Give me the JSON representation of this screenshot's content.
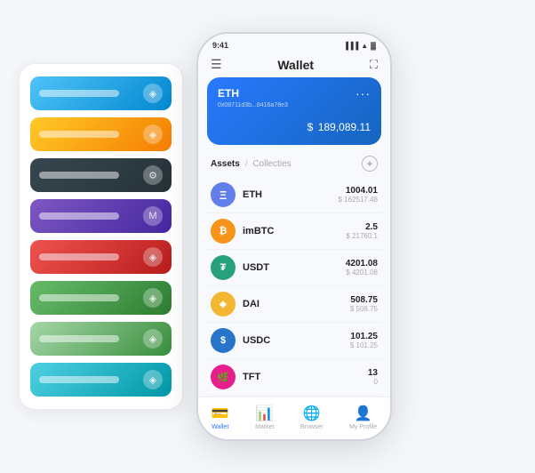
{
  "left_panel": {
    "cards": [
      {
        "id": "card-blue",
        "color_class": "card-blue",
        "icon": "◈"
      },
      {
        "id": "card-orange",
        "color_class": "card-orange",
        "icon": "◈"
      },
      {
        "id": "card-dark",
        "color_class": "card-dark",
        "icon": "⚙"
      },
      {
        "id": "card-purple",
        "color_class": "card-purple",
        "icon": "M"
      },
      {
        "id": "card-red",
        "color_class": "card-red",
        "icon": "◈"
      },
      {
        "id": "card-green",
        "color_class": "card-green",
        "icon": "◈"
      },
      {
        "id": "card-lightgreen",
        "color_class": "card-lightgreen",
        "icon": "◈"
      },
      {
        "id": "card-skyblue",
        "color_class": "card-skyblue",
        "icon": "◈"
      }
    ]
  },
  "phone": {
    "status_bar": {
      "time": "9:41",
      "signal": "▐▐▐",
      "wifi": "WiFi",
      "battery": "🔋"
    },
    "nav": {
      "menu_icon": "☰",
      "title": "Wallet",
      "expand_icon": "⛶"
    },
    "eth_card": {
      "label": "ETH",
      "address": "0x08711d3b...8416a78e3",
      "copy_icon": "⊡",
      "more_icon": "···",
      "balance_currency": "$",
      "balance": "189,089.11"
    },
    "assets": {
      "tab_active": "Assets",
      "separator": "/",
      "tab_inactive": "Collecties",
      "add_icon": "+"
    },
    "tokens": [
      {
        "symbol": "ETH",
        "icon_bg": "#627eea",
        "icon_text": "Ξ",
        "icon_color": "#fff",
        "amount": "1004.01",
        "usd": "$ 162517.48"
      },
      {
        "symbol": "imBTC",
        "icon_bg": "#f7931a",
        "icon_text": "₿",
        "icon_color": "#fff",
        "amount": "2.5",
        "usd": "$ 21760.1"
      },
      {
        "symbol": "USDT",
        "icon_bg": "#26a17b",
        "icon_text": "₮",
        "icon_color": "#fff",
        "amount": "4201.08",
        "usd": "$ 4201.08"
      },
      {
        "symbol": "DAI",
        "icon_bg": "#f4b731",
        "icon_text": "◈",
        "icon_color": "#fff",
        "amount": "508.75",
        "usd": "$ 508.75"
      },
      {
        "symbol": "USDC",
        "icon_bg": "#2775ca",
        "icon_text": "$",
        "icon_color": "#fff",
        "amount": "101.25",
        "usd": "$ 101.25"
      },
      {
        "symbol": "TFT",
        "icon_bg": "#e91e8c",
        "icon_text": "🌿",
        "icon_color": "#fff",
        "amount": "13",
        "usd": "0"
      }
    ],
    "bottom_nav": [
      {
        "id": "wallet",
        "icon": "💳",
        "label": "Wallet",
        "active": true
      },
      {
        "id": "market",
        "icon": "📊",
        "label": "Market",
        "active": false
      },
      {
        "id": "browser",
        "icon": "🌐",
        "label": "Browser",
        "active": false
      },
      {
        "id": "profile",
        "icon": "👤",
        "label": "My Profile",
        "active": false
      }
    ]
  }
}
